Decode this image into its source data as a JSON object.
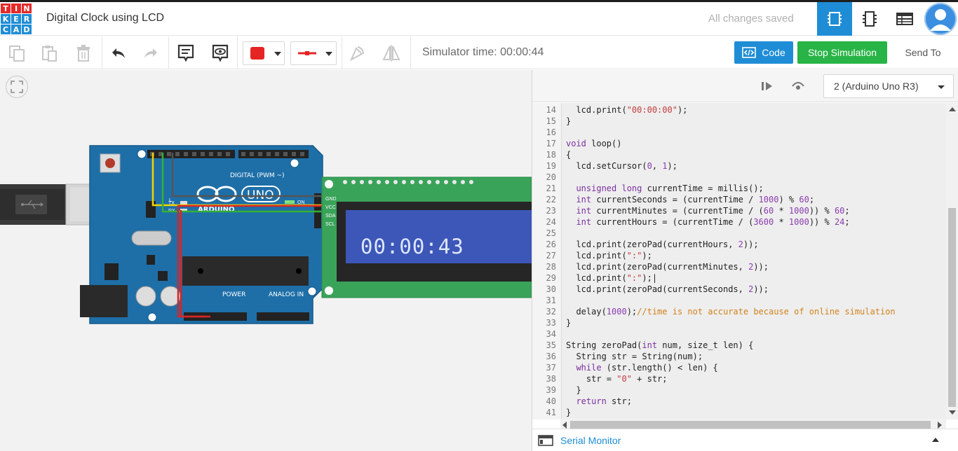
{
  "app": {
    "logo_letters": [
      "T",
      "I",
      "N",
      "K",
      "E",
      "R",
      "C",
      "A",
      "D"
    ],
    "logo_colors": [
      "#e42a2a",
      "#e42a2a",
      "#e42a2a",
      "#1f8dd6",
      "#1f8dd6",
      "#1f8dd6",
      "#1f8dd6",
      "#1f8dd6",
      "#1f8dd6"
    ],
    "title": "Digital Clock using LCD",
    "save_status": "All changes saved"
  },
  "header": {
    "views": [
      {
        "name": "circuit-view-icon",
        "active": true
      },
      {
        "name": "schematic-view-icon",
        "active": false
      },
      {
        "name": "component-list-icon",
        "active": false
      }
    ]
  },
  "toolbar": {
    "icons": [
      "copy-icon",
      "paste-icon",
      "delete-icon",
      "undo-icon",
      "redo-icon",
      "notes-icon",
      "notes-visibility-icon",
      "rotate-icon",
      "flip-icon"
    ],
    "color_swatch": "#e62424",
    "wire_color": "#e62424",
    "sim_time": "Simulator time: 00:00:44",
    "code_label": "Code",
    "stop_label": "Stop Simulation",
    "send_label": "Send To"
  },
  "circuit": {
    "lcd_text": "00:00:43",
    "arduino_logo": "ARDUINO",
    "arduino_model": "UNO",
    "pin_labels_top": "DIGITAL (PWM ~)",
    "power_label": "POWER",
    "analog_label": "ANALOG IN",
    "on_label": "ON",
    "tx_label": "TX",
    "rx_label": "RX",
    "l_label": "L",
    "lcd_pins": [
      "GND",
      "VCC",
      "SDA",
      "SCL"
    ]
  },
  "code_panel": {
    "board": "2 (Arduino Uno R3)",
    "lines": [
      {
        "n": "14",
        "html": "  lcd.print(<span class=\"str\">\"00:00:00\"</span>);"
      },
      {
        "n": "15",
        "html": "}"
      },
      {
        "n": "16",
        "html": ""
      },
      {
        "n": "17",
        "html": "<span class=\"ty\">void</span> loop()"
      },
      {
        "n": "18",
        "html": "{"
      },
      {
        "n": "19",
        "html": "  lcd.setCursor(<span class=\"num\">0</span>, <span class=\"num\">1</span>);"
      },
      {
        "n": "20",
        "html": ""
      },
      {
        "n": "21",
        "html": "  <span class=\"ty\">unsigned long</span> currentTime = millis();"
      },
      {
        "n": "22",
        "html": "  <span class=\"ty\">int</span> currentSeconds = (currentTime / <span class=\"num\">1000</span>) % <span class=\"num\">60</span>;"
      },
      {
        "n": "23",
        "html": "  <span class=\"ty\">int</span> currentMinutes = (currentTime / (<span class=\"num\">60</span> * <span class=\"num\">1000</span>)) % <span class=\"num\">60</span>;"
      },
      {
        "n": "24",
        "html": "  <span class=\"ty\">int</span> currentHours = (currentTime / (<span class=\"num\">3600</span> * <span class=\"num\">1000</span>)) % <span class=\"num\">24</span>;"
      },
      {
        "n": "25",
        "html": ""
      },
      {
        "n": "26",
        "html": "  lcd.print(zeroPad(currentHours, <span class=\"num\">2</span>));"
      },
      {
        "n": "27",
        "html": "  lcd.print(<span class=\"str\">\":\"</span>);"
      },
      {
        "n": "28",
        "html": "  lcd.print(zeroPad(currentMinutes, <span class=\"num\">2</span>));"
      },
      {
        "n": "29",
        "html": "  lcd.print(<span class=\"str\">\":\"</span>);|"
      },
      {
        "n": "30",
        "html": "  lcd.print(zeroPad(currentSeconds, <span class=\"num\">2</span>));"
      },
      {
        "n": "31",
        "html": ""
      },
      {
        "n": "32",
        "html": "  delay(<span class=\"num\">1000</span>);<span class=\"cm\">//time is not accurate because of online simulation</span>"
      },
      {
        "n": "33",
        "html": "}"
      },
      {
        "n": "34",
        "html": ""
      },
      {
        "n": "35",
        "html": "String zeroPad(<span class=\"ty\">int</span> num, size_t len) {"
      },
      {
        "n": "36",
        "html": "  String str = String(num);"
      },
      {
        "n": "37",
        "html": "  <span class=\"kw\">while</span> (str.length() &lt; len) {"
      },
      {
        "n": "38",
        "html": "    str = <span class=\"str\">\"0\"</span> + str;"
      },
      {
        "n": "39",
        "html": "  }"
      },
      {
        "n": "40",
        "html": "  <span class=\"kw\">return</span> str;"
      },
      {
        "n": "41",
        "html": "}"
      }
    ],
    "serial_monitor_label": "Serial Monitor"
  }
}
